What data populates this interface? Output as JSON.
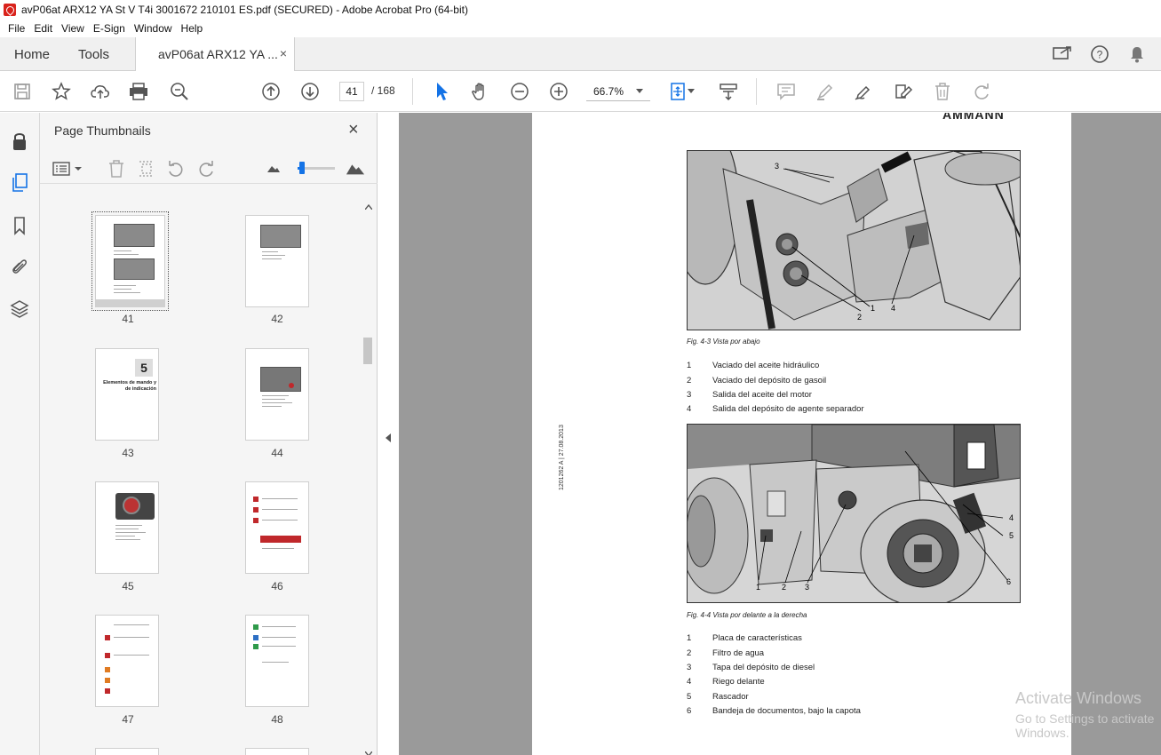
{
  "window": {
    "title": "avP06at ARX12 YA St V T4i 3001672 210101 ES.pdf (SECURED) - Adobe Acrobat Pro (64-bit)"
  },
  "menu": [
    "File",
    "Edit",
    "View",
    "E-Sign",
    "Window",
    "Help"
  ],
  "tabs": {
    "home": "Home",
    "tools": "Tools",
    "doc": "avP06at ARX12 YA ...",
    "doc_close": "×"
  },
  "toolbar": {
    "page_current": "41",
    "page_total": "/ 168",
    "zoom": "66.7%"
  },
  "panel": {
    "title": "Page Thumbnails",
    "close": "×",
    "slider_level": 0.1
  },
  "thumbnails": [
    "41",
    "42",
    "43",
    "44",
    "45",
    "46",
    "47",
    "48"
  ],
  "thumb43": {
    "number": "5",
    "heading": "Elementos de mando y de indicación"
  },
  "page": {
    "brand": "AMMANN",
    "side_id": "1201262 A | 27.08.2013",
    "fig1": {
      "callouts": [
        "3",
        "2",
        "1",
        "4"
      ],
      "caption": "Fig. 4-3 Vista por abajo",
      "legend": [
        {
          "n": "1",
          "text": "Vaciado del aceite hidráulico"
        },
        {
          "n": "2",
          "text": "Vaciado del depósito de gasoil"
        },
        {
          "n": "3",
          "text": "Salida del aceite del motor"
        },
        {
          "n": "4",
          "text": "Salida del depósito de agente separador"
        }
      ]
    },
    "fig2": {
      "callouts": [
        "4",
        "5",
        "6",
        "1",
        "2",
        "3"
      ],
      "caption": "Fig. 4-4 Vista por delante a la derecha",
      "legend": [
        {
          "n": "1",
          "text": "Placa de características"
        },
        {
          "n": "2",
          "text": "Filtro de agua"
        },
        {
          "n": "3",
          "text": "Tapa del depósito de diesel"
        },
        {
          "n": "4",
          "text": "Riego delante"
        },
        {
          "n": "5",
          "text": "Rascador"
        },
        {
          "n": "6",
          "text": "Bandeja de documentos, bajo la capota"
        }
      ]
    }
  },
  "watermark": {
    "line1": "Activate Windows",
    "line2": "Go to Settings to activate Windows."
  }
}
